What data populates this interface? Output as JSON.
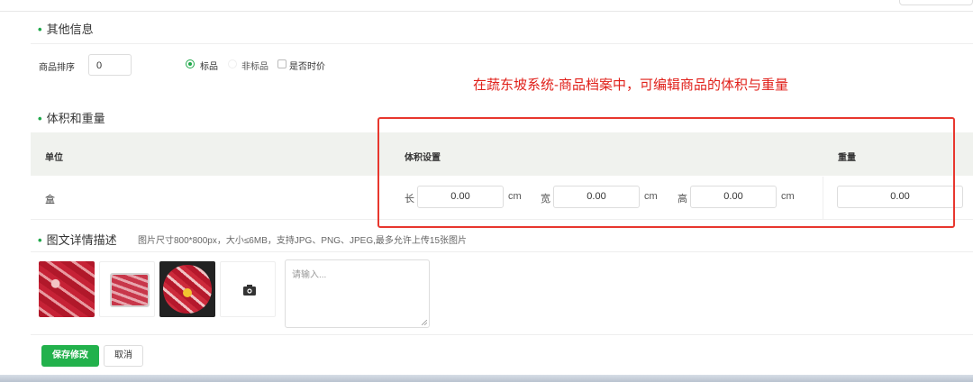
{
  "other_info": {
    "title": "其他信息",
    "sort_label": "商品排序",
    "sort_value": "0",
    "radio_standard": "标品",
    "radio_nonstandard": "非标品",
    "checkbox_seasonal": "是否时价",
    "standard_selected": true
  },
  "annotation": "在蔬东坡系统-商品档案中，可编辑商品的体积与重量",
  "volume_weight": {
    "title": "体积和重量",
    "col_unit": "单位",
    "col_volume": "体积设置",
    "col_weight": "重量",
    "row_unit": "盒",
    "length_label": "长",
    "length_value": "0.00",
    "width_label": "宽",
    "width_value": "0.00",
    "height_label": "高",
    "height_value": "0.00",
    "cm": "cm",
    "weight_value": "0.00"
  },
  "description": {
    "title": "图文详情描述",
    "hint": "图片尺寸800*800px，大小≤6MB，支持JPG、PNG、JPEG,最多允许上传15张图片",
    "textarea_placeholder": "请输入..."
  },
  "actions": {
    "save": "保存修改",
    "cancel": "取消"
  },
  "colors": {
    "accent": "#22b14c",
    "annotation": "#e0201a"
  }
}
